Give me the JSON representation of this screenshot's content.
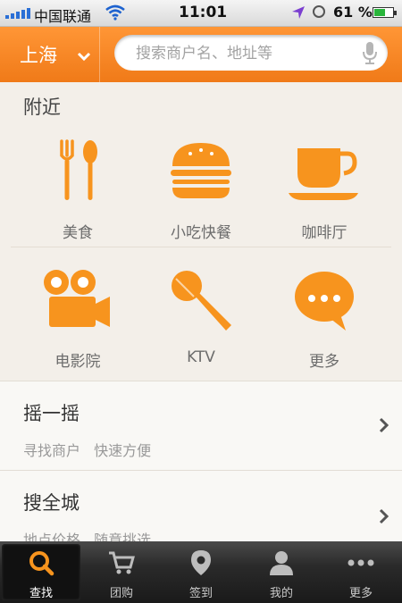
{
  "status_bar": {
    "carrier": "中国联通",
    "time": "11:01",
    "battery": "61 %",
    "battery_level": 0.61
  },
  "header": {
    "city": "上海",
    "search_placeholder": "搜索商户名、地址等"
  },
  "nearby": {
    "title": "附近",
    "categories": [
      {
        "label": "美食",
        "icon": "fork-spoon-icon"
      },
      {
        "label": "小吃快餐",
        "icon": "burger-icon"
      },
      {
        "label": "咖啡厅",
        "icon": "coffee-cup-icon"
      },
      {
        "label": "电影院",
        "icon": "movie-camera-icon"
      },
      {
        "label": "KTV",
        "icon": "microphone-icon"
      },
      {
        "label": "更多",
        "icon": "chat-bubble-icon"
      }
    ]
  },
  "rows": [
    {
      "title": "摇一摇",
      "subtitle": "寻找商户 快速方便"
    },
    {
      "title": "搜全城",
      "subtitle": "地点价格 随意挑选"
    }
  ],
  "tabs": [
    {
      "label": "查找",
      "icon": "search-icon",
      "active": true
    },
    {
      "label": "团购",
      "icon": "cart-icon",
      "active": false
    },
    {
      "label": "签到",
      "icon": "location-pin-icon",
      "active": false
    },
    {
      "label": "我的",
      "icon": "user-icon",
      "active": false
    },
    {
      "label": "更多",
      "icon": "more-dots-icon",
      "active": false
    }
  ],
  "colors": {
    "brand_orange": "#f5861f",
    "icon_orange": "#f7941e"
  }
}
